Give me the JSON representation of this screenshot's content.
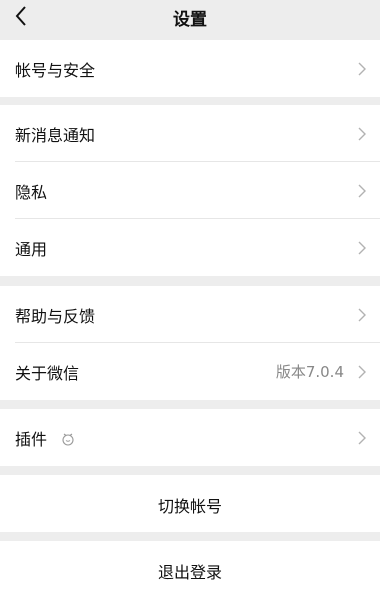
{
  "header": {
    "title": "设置",
    "back_icon": "chevron-left-icon"
  },
  "group1": {
    "items": [
      {
        "label": "帐号与安全"
      }
    ]
  },
  "group2": {
    "items": [
      {
        "label": "新消息通知"
      },
      {
        "label": "隐私"
      },
      {
        "label": "通用"
      }
    ]
  },
  "group3": {
    "items": [
      {
        "label": "帮助与反馈"
      },
      {
        "label": "关于微信",
        "value": "版本7.0.4"
      }
    ]
  },
  "group4": {
    "items": [
      {
        "label": "插件",
        "icon": "plugin-icon"
      }
    ]
  },
  "actions": {
    "switch_account": "切换帐号",
    "logout": "退出登录"
  },
  "colors": {
    "background": "#ededed",
    "card": "#ffffff",
    "secondary_text": "#888888",
    "chevron": "#b2b2b2"
  }
}
